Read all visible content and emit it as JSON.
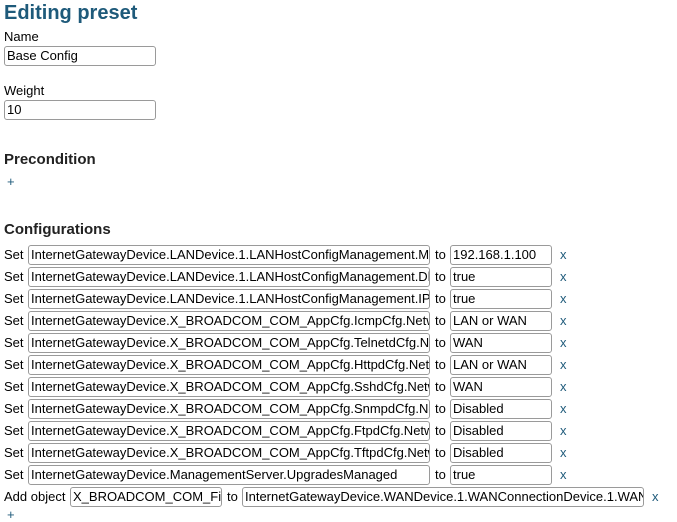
{
  "page": {
    "title": "Editing preset"
  },
  "fields": {
    "name_label": "Name",
    "name_value": "Base Config",
    "weight_label": "Weight",
    "weight_value": "10"
  },
  "precondition": {
    "heading": "Precondition",
    "add_label": "+"
  },
  "configurations": {
    "heading": "Configurations",
    "to_label": "to",
    "delete_label": "x",
    "add_label": "+",
    "rows": [
      {
        "verb": "Set",
        "param": "InternetGatewayDevice.LANDevice.1.LANHostConfigManagement.Mi",
        "value": "192.168.1.100"
      },
      {
        "verb": "Set",
        "param": "InternetGatewayDevice.LANDevice.1.LANHostConfigManagement.Dh",
        "value": "true"
      },
      {
        "verb": "Set",
        "param": "InternetGatewayDevice.LANDevice.1.LANHostConfigManagement.IP",
        "value": "true"
      },
      {
        "verb": "Set",
        "param": "InternetGatewayDevice.X_BROADCOM_COM_AppCfg.IcmpCfg.Netw",
        "value": "LAN or WAN"
      },
      {
        "verb": "Set",
        "param": "InternetGatewayDevice.X_BROADCOM_COM_AppCfg.TelnetdCfg.N",
        "value": "WAN"
      },
      {
        "verb": "Set",
        "param": "InternetGatewayDevice.X_BROADCOM_COM_AppCfg.HttpdCfg.Netw",
        "value": "LAN or WAN"
      },
      {
        "verb": "Set",
        "param": "InternetGatewayDevice.X_BROADCOM_COM_AppCfg.SshdCfg.Netw",
        "value": "WAN"
      },
      {
        "verb": "Set",
        "param": "InternetGatewayDevice.X_BROADCOM_COM_AppCfg.SnmpdCfg.Ne",
        "value": "Disabled"
      },
      {
        "verb": "Set",
        "param": "InternetGatewayDevice.X_BROADCOM_COM_AppCfg.FtpdCfg.Netw",
        "value": "Disabled"
      },
      {
        "verb": "Set",
        "param": "InternetGatewayDevice.X_BROADCOM_COM_AppCfg.TftpdCfg.Netw",
        "value": "Disabled"
      },
      {
        "verb": "Set",
        "param": "InternetGatewayDevice.ManagementServer.UpgradesManaged",
        "value": "true"
      }
    ],
    "add_object_row": {
      "verb": "Add object",
      "object": "X_BROADCOM_COM_Fi",
      "target": "InternetGatewayDevice.WANDevice.1.WANConnectionDevice.1.WAN"
    }
  }
}
